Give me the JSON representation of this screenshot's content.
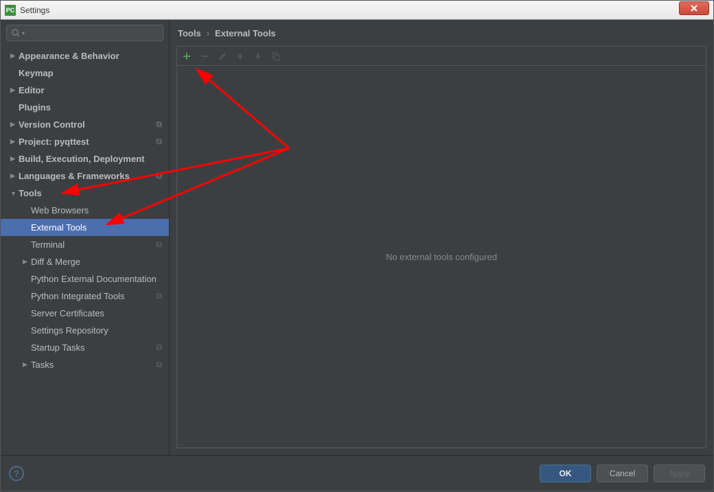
{
  "titlebar": {
    "icon_text": "PC",
    "title": "Settings"
  },
  "search": {
    "placeholder": ""
  },
  "tree": [
    {
      "label": "Appearance & Behavior",
      "level": 0,
      "expandable": true,
      "bold": true
    },
    {
      "label": "Keymap",
      "level": 0,
      "bold": true
    },
    {
      "label": "Editor",
      "level": 0,
      "expandable": true,
      "bold": true
    },
    {
      "label": "Plugins",
      "level": 0,
      "bold": true
    },
    {
      "label": "Version Control",
      "level": 0,
      "expandable": true,
      "bold": true,
      "storage": true
    },
    {
      "label": "Project: pyqttest",
      "level": 0,
      "expandable": true,
      "bold": true,
      "storage": true
    },
    {
      "label": "Build, Execution, Deployment",
      "level": 0,
      "expandable": true,
      "bold": true
    },
    {
      "label": "Languages & Frameworks",
      "level": 0,
      "expandable": true,
      "bold": true,
      "storage": true
    },
    {
      "label": "Tools",
      "level": 0,
      "expandable": true,
      "expanded": true,
      "bold": true
    },
    {
      "label": "Web Browsers",
      "level": 1
    },
    {
      "label": "External Tools",
      "level": 1,
      "selected": true
    },
    {
      "label": "Terminal",
      "level": 1,
      "storage": true
    },
    {
      "label": "Diff & Merge",
      "level": 1,
      "expandable": true
    },
    {
      "label": "Python External Documentation",
      "level": 1
    },
    {
      "label": "Python Integrated Tools",
      "level": 1,
      "storage": true
    },
    {
      "label": "Server Certificates",
      "level": 1
    },
    {
      "label": "Settings Repository",
      "level": 1
    },
    {
      "label": "Startup Tasks",
      "level": 1,
      "storage": true
    },
    {
      "label": "Tasks",
      "level": 1,
      "expandable": true,
      "storage": true
    }
  ],
  "breadcrumb": {
    "root": "Tools",
    "sep": "›",
    "leaf": "External Tools"
  },
  "panel": {
    "empty_text": "No external tools configured"
  },
  "footer": {
    "ok": "OK",
    "cancel": "Cancel",
    "apply": "Apply"
  }
}
